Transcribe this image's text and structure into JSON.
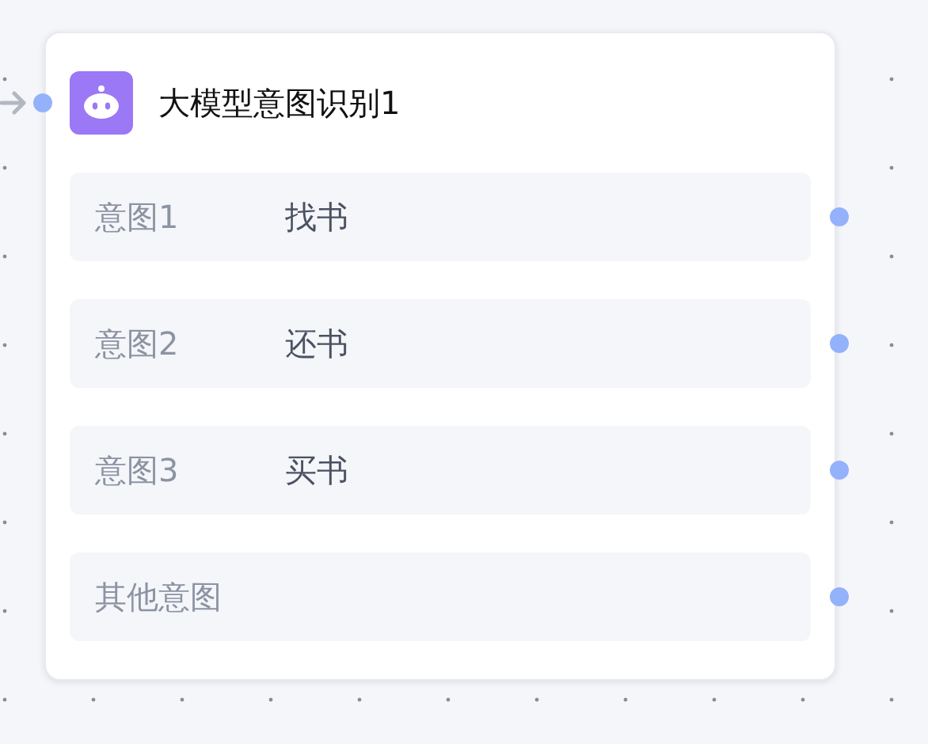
{
  "node": {
    "title": "大模型意图识别1",
    "intents": [
      {
        "label": "意图1",
        "value": "找书"
      },
      {
        "label": "意图2",
        "value": "还书"
      },
      {
        "label": "意图3",
        "value": "买书"
      },
      {
        "label": "其他意图"
      }
    ]
  }
}
